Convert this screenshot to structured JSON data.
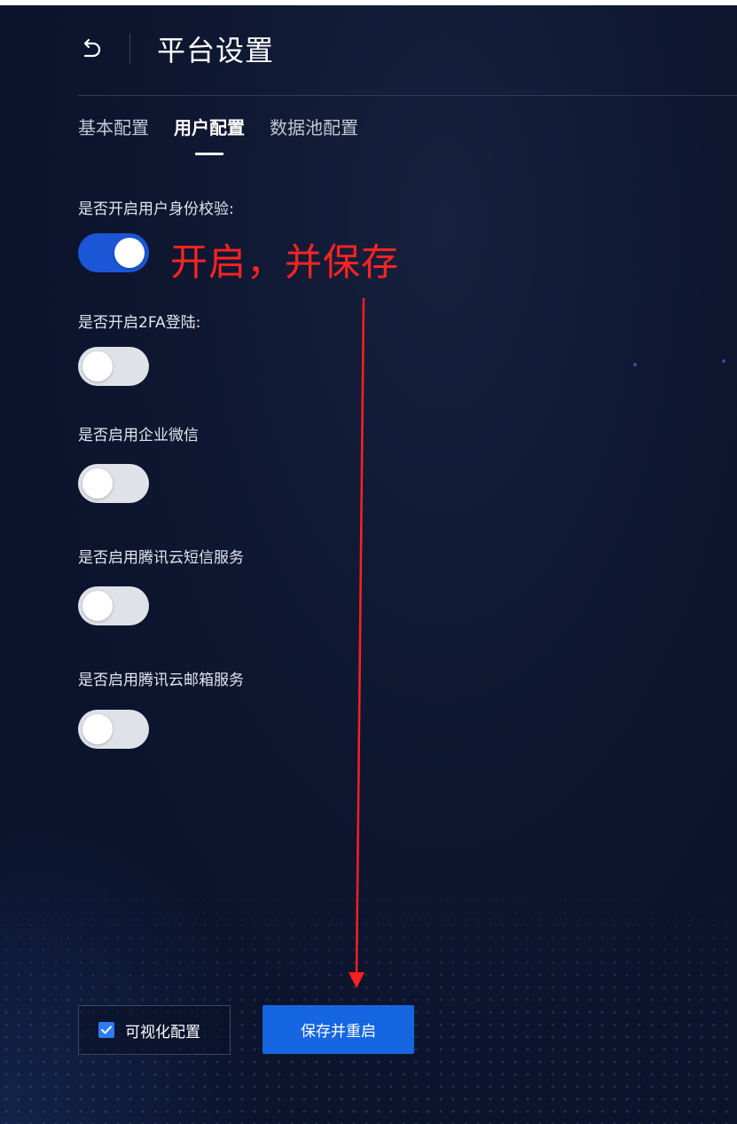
{
  "header": {
    "title": "平台设置",
    "back_icon": "undo-arrow-icon"
  },
  "tabs": [
    {
      "label": "基本配置",
      "active": false
    },
    {
      "label": "用户配置",
      "active": true
    },
    {
      "label": "数据池配置",
      "active": false
    }
  ],
  "settings": [
    {
      "label": "是否开启用户身份校验:",
      "enabled": true
    },
    {
      "label": "是否开启2FA登陆:",
      "enabled": false
    },
    {
      "label": "是否启用企业微信",
      "enabled": false
    },
    {
      "label": "是否启用腾讯云短信服务",
      "enabled": false
    },
    {
      "label": "是否启用腾讯云邮箱服务",
      "enabled": false
    }
  ],
  "annotation": {
    "text": "开启，并保存",
    "color": "#ff2323"
  },
  "footer": {
    "visual_config_label": "可视化配置",
    "visual_config_checked": true,
    "save_label": "保存并重启"
  },
  "colors": {
    "accent": "#1566e0",
    "switch_on": "#1a56d6",
    "background": "#0e1630"
  }
}
